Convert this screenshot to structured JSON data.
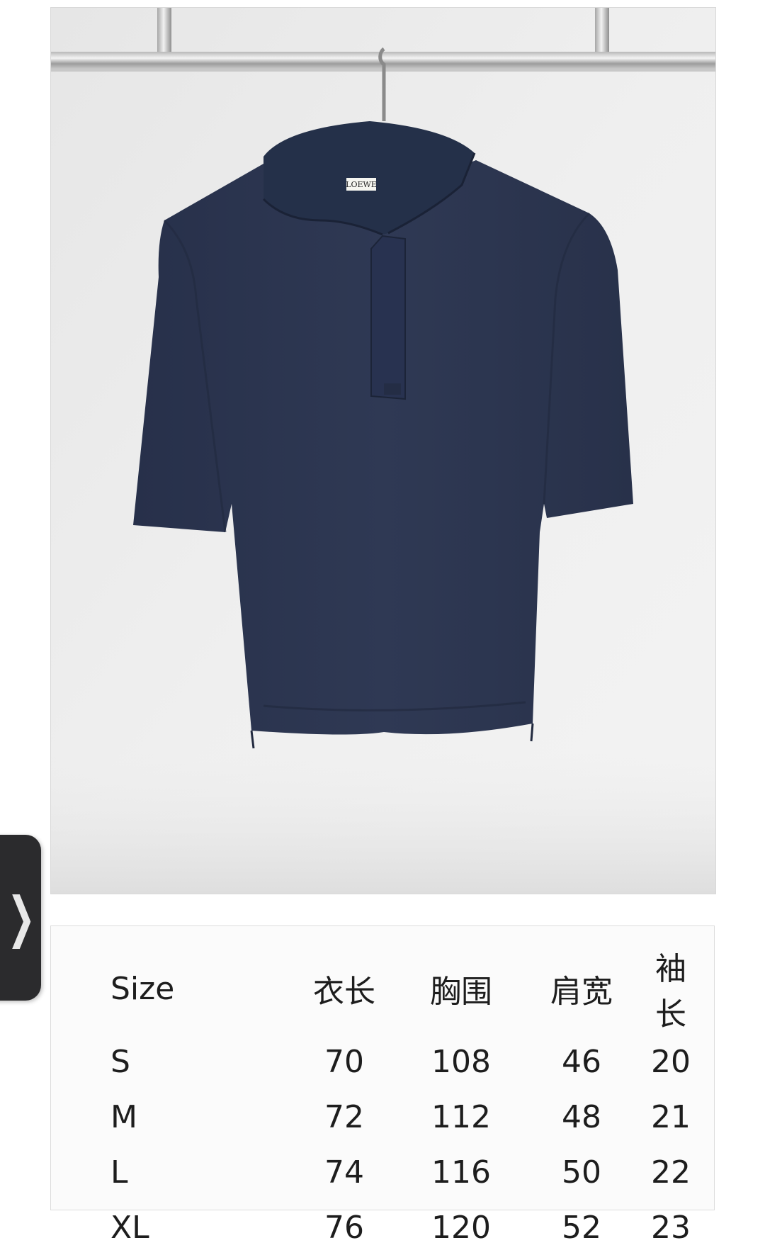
{
  "product_photo": {
    "label_brand": "LOEWE",
    "garment_color": "#2c3650"
  },
  "size_table": {
    "headers": [
      "Size",
      "衣长",
      "胸围",
      "肩宽",
      "袖长"
    ],
    "rows": [
      [
        "S",
        "70",
        "108",
        "46",
        "20"
      ],
      [
        "M",
        "72",
        "112",
        "48",
        "21"
      ],
      [
        "L",
        "74",
        "116",
        "50",
        "22"
      ],
      [
        "XL",
        "76",
        "120",
        "52",
        "23"
      ]
    ]
  },
  "side_tab": {
    "icon": "chevron-right-icon",
    "glyph": "❯"
  }
}
